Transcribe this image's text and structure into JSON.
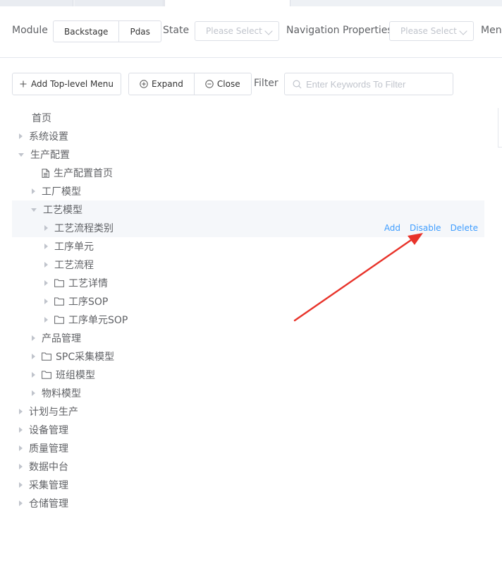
{
  "toolbar": {
    "module_label": "Module",
    "module_options": [
      "Backstage",
      "Pdas"
    ],
    "state_label": "State",
    "state_placeholder": "Please Select",
    "nav_label": "Navigation Properties",
    "nav_placeholder": "Please Select",
    "menu_label_partial": "Menu"
  },
  "actions_bar": {
    "add_top_label": "Add Top-level Menu",
    "expand_label": "Expand",
    "close_label": "Close",
    "filter_label": "Filter",
    "filter_placeholder": "Enter Keywords To Filter"
  },
  "tree": {
    "items": [
      {
        "label": "首页",
        "caret": "none",
        "icon": ""
      },
      {
        "label": "系统设置",
        "caret": "right",
        "icon": ""
      },
      {
        "label": "生产配置",
        "caret": "down",
        "icon": ""
      },
      {
        "label": "生产配置首页",
        "caret": "none",
        "icon": "document-icon"
      },
      {
        "label": "工厂模型",
        "caret": "right",
        "icon": ""
      },
      {
        "label": "工艺模型",
        "caret": "down",
        "icon": ""
      },
      {
        "label": "工艺流程类别",
        "caret": "right",
        "icon": ""
      },
      {
        "label": "工序单元",
        "caret": "right",
        "icon": ""
      },
      {
        "label": "工艺流程",
        "caret": "right",
        "icon": ""
      },
      {
        "label": "工艺详情",
        "caret": "right",
        "icon": "folder-icon"
      },
      {
        "label": "工序SOP",
        "caret": "right",
        "icon": "folder-icon"
      },
      {
        "label": "工序单元SOP",
        "caret": "right",
        "icon": "folder-icon"
      },
      {
        "label": "产品管理",
        "caret": "right",
        "icon": ""
      },
      {
        "label": "SPC采集模型",
        "caret": "right",
        "icon": "folder-icon"
      },
      {
        "label": "班组模型",
        "caret": "right",
        "icon": "folder-icon"
      },
      {
        "label": "物料模型",
        "caret": "right",
        "icon": ""
      },
      {
        "label": "计划与生产",
        "caret": "right",
        "icon": ""
      },
      {
        "label": "设备管理",
        "caret": "right",
        "icon": ""
      },
      {
        "label": "质量管理",
        "caret": "right",
        "icon": ""
      },
      {
        "label": "数据中台",
        "caret": "right",
        "icon": ""
      },
      {
        "label": "采集管理",
        "caret": "right",
        "icon": ""
      },
      {
        "label": "仓储管理",
        "caret": "right",
        "icon": ""
      }
    ],
    "row_actions": {
      "add": "Add",
      "disable": "Disable",
      "delete": "Delete"
    }
  },
  "colors": {
    "link": "#409eff",
    "arrow": "#e8332a",
    "highlight_row": "#f5f7fa",
    "border": "#dcdfe6"
  }
}
